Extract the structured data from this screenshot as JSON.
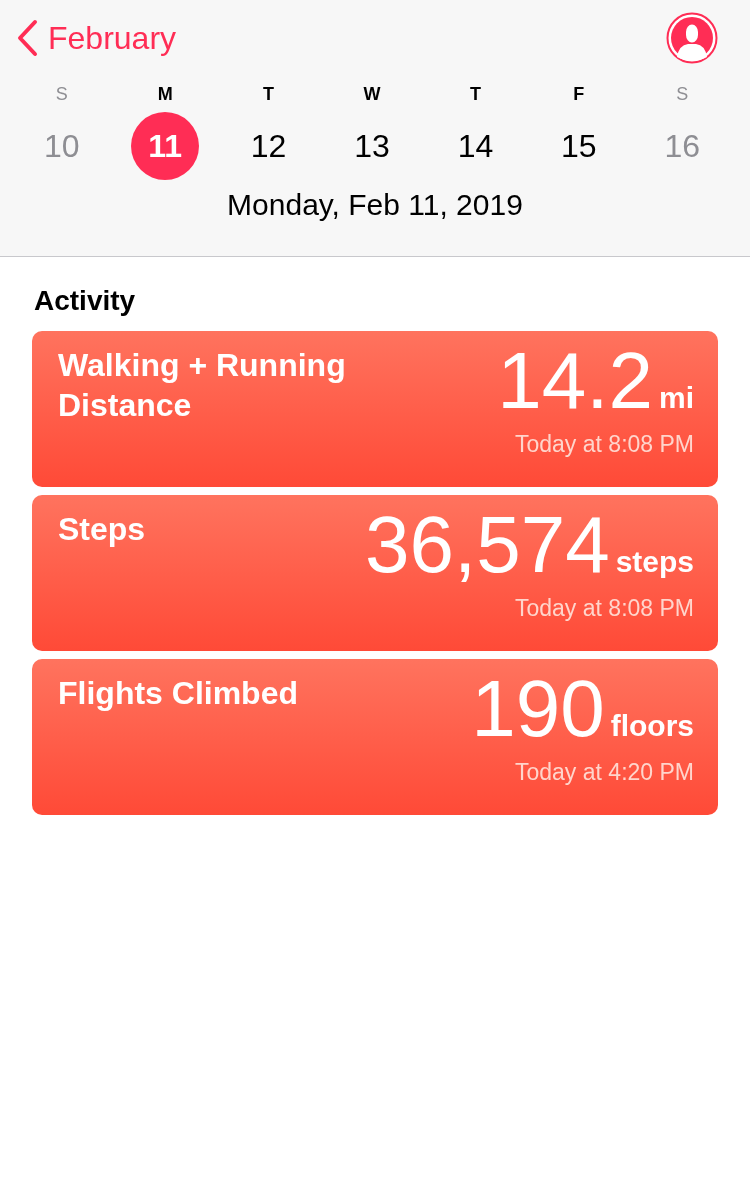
{
  "header": {
    "back_label": "February",
    "days": [
      {
        "letter": "S",
        "number": "10",
        "selected": false,
        "dimmed": true
      },
      {
        "letter": "M",
        "number": "11",
        "selected": true,
        "dimmed": false
      },
      {
        "letter": "T",
        "number": "12",
        "selected": false,
        "dimmed": false
      },
      {
        "letter": "W",
        "number": "13",
        "selected": false,
        "dimmed": false
      },
      {
        "letter": "T",
        "number": "14",
        "selected": false,
        "dimmed": false
      },
      {
        "letter": "F",
        "number": "15",
        "selected": false,
        "dimmed": false
      },
      {
        "letter": "S",
        "number": "16",
        "selected": false,
        "dimmed": true
      }
    ],
    "date_line": "Monday, Feb 11, 2019"
  },
  "section_title": "Activity",
  "cards": [
    {
      "title": "Walking + Running Distance",
      "value": "14.2",
      "unit": "mi",
      "time": "Today at 8:08 PM"
    },
    {
      "title": "Steps",
      "value": "36,574",
      "unit": "steps",
      "time": "Today at 8:08 PM"
    },
    {
      "title": "Flights Climbed",
      "value": "190",
      "unit": "floors",
      "time": "Today at 4:20 PM"
    }
  ]
}
